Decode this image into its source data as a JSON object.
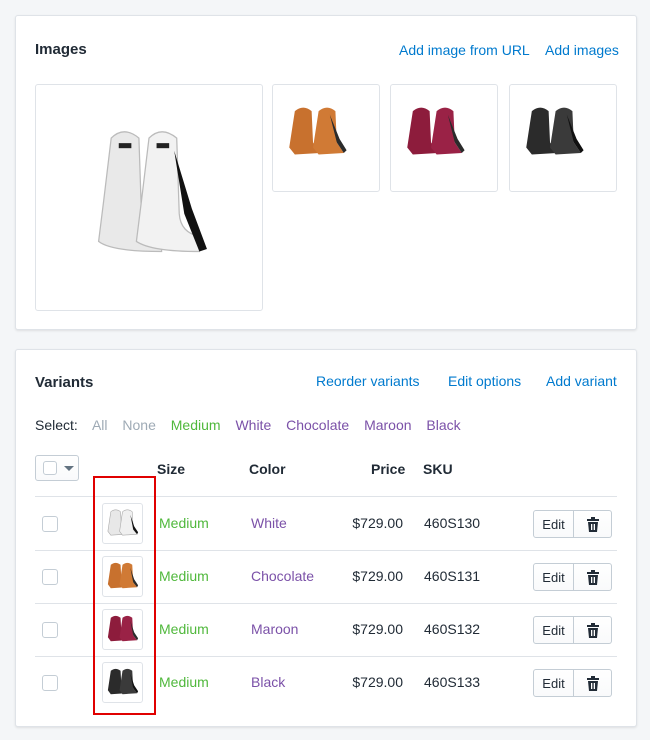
{
  "images": {
    "title": "Images",
    "add_from_url": "Add image from URL",
    "add_images": "Add images",
    "items": [
      {
        "alt": "White seat",
        "color": "#e8e8e8",
        "accent": "#111111"
      },
      {
        "alt": "Chocolate seat",
        "color": "#c8712e",
        "accent": "#8a4716"
      },
      {
        "alt": "Maroon seat",
        "color": "#8d1c3c",
        "accent": "#5a0f24"
      },
      {
        "alt": "Black seat",
        "color": "#2b2b2b",
        "accent": "#111111"
      }
    ]
  },
  "variants": {
    "title": "Variants",
    "reorder": "Reorder variants",
    "edit_options": "Edit options",
    "add_variant": "Add variant",
    "select": {
      "label": "Select:",
      "all": "All",
      "none": "None",
      "medium": "Medium",
      "white": "White",
      "chocolate": "Chocolate",
      "maroon": "Maroon",
      "black": "Black"
    },
    "columns": {
      "size": "Size",
      "color": "Color",
      "price": "Price",
      "sku": "SKU"
    },
    "rows": [
      {
        "size": "Medium",
        "color": "White",
        "price": "$729.00",
        "sku": "460S130",
        "edit": "Edit",
        "seat_color": "#e8e8e8"
      },
      {
        "size": "Medium",
        "color": "Chocolate",
        "price": "$729.00",
        "sku": "460S131",
        "edit": "Edit",
        "seat_color": "#c8712e"
      },
      {
        "size": "Medium",
        "color": "Maroon",
        "price": "$729.00",
        "sku": "460S132",
        "edit": "Edit",
        "seat_color": "#8d1c3c"
      },
      {
        "size": "Medium",
        "color": "Black",
        "price": "$729.00",
        "sku": "460S133",
        "edit": "Edit",
        "seat_color": "#2b2b2b"
      }
    ]
  },
  "colors": {
    "link": "#007ace",
    "size": "#50b83c",
    "color": "#7b51a8",
    "highlight": "#e00000"
  }
}
